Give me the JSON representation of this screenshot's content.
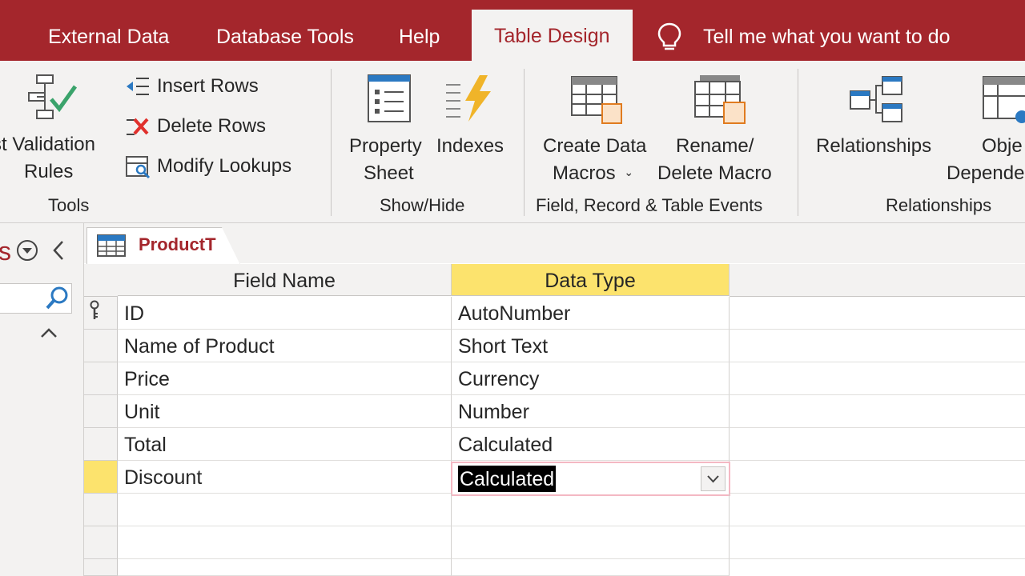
{
  "tabs": {
    "external_data": "External Data",
    "database_tools": "Database Tools",
    "help": "Help",
    "table_design": "Table Design"
  },
  "tell_me": "Tell me what you want to do",
  "ribbon": {
    "tools": {
      "test_validation_l1": "st Validation",
      "test_validation_l2": "Rules",
      "insert_rows": "Insert Rows",
      "delete_rows": "Delete Rows",
      "modify_lookups": "Modify Lookups",
      "group": "Tools"
    },
    "show_hide": {
      "property_sheet_l1": "Property",
      "property_sheet_l2": "Sheet",
      "indexes": "Indexes",
      "group": "Show/Hide"
    },
    "events": {
      "create_macros_l1": "Create Data",
      "create_macros_l2": "Macros",
      "rename_l1": "Rename/",
      "rename_l2": "Delete Macro",
      "group": "Field, Record & Table Events"
    },
    "relationships": {
      "relationships": "Relationships",
      "obj_dep_l1": "Obje",
      "obj_dep_l2": "Depende",
      "group": "Relationships"
    }
  },
  "nav": {
    "title_fragment": "s"
  },
  "document_tab": "ProductT",
  "grid": {
    "headers": {
      "field_name": "Field Name",
      "data_type": "Data Type"
    },
    "rows": [
      {
        "field": "ID",
        "type": "AutoNumber"
      },
      {
        "field": "Name of Product",
        "type": "Short Text"
      },
      {
        "field": "Price",
        "type": "Currency"
      },
      {
        "field": "Unit",
        "type": "Number"
      },
      {
        "field": "Total",
        "type": "Calculated"
      },
      {
        "field": "Discount",
        "type": "Calculated"
      }
    ]
  },
  "colors": {
    "accent": "#a4262c",
    "highlight": "#fce36d"
  }
}
